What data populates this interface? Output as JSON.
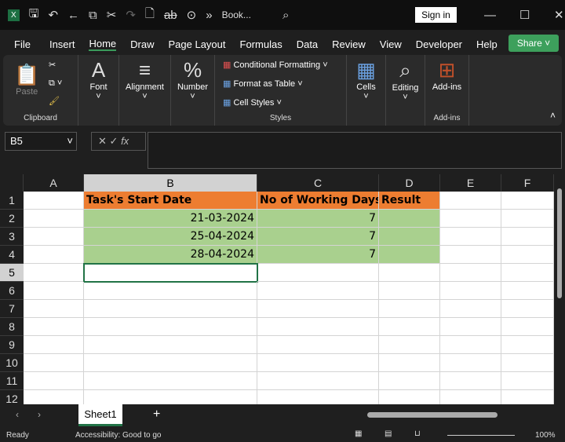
{
  "titlebar": {
    "title": "Book...",
    "sign_in": "Sign in"
  },
  "menu": [
    "File",
    "Insert",
    "Home",
    "Draw",
    "Page Layout",
    "Formulas",
    "Data",
    "Review",
    "View",
    "Developer",
    "Help"
  ],
  "share": "Share",
  "ribbon": {
    "paste": "Paste",
    "clipboard": "Clipboard",
    "font": "Font",
    "alignment": "Alignment",
    "number": "Number",
    "conditional_formatting": "Conditional Formatting",
    "format_as_table": "Format as Table",
    "cell_styles": "Cell Styles",
    "styles": "Styles",
    "cells": "Cells",
    "editing": "Editing",
    "addins": "Add-ins",
    "addins_group": "Add-ins"
  },
  "formula_bar": {
    "name_box": "B5",
    "fx": "fx",
    "value": ""
  },
  "columns": [
    "A",
    "B",
    "C",
    "D",
    "E",
    "F"
  ],
  "rows": [
    "1",
    "2",
    "3",
    "4",
    "5",
    "6",
    "7",
    "8",
    "9",
    "10",
    "11",
    "12"
  ],
  "table": {
    "headers": [
      "Task's Start Date",
      "No of Working Days",
      "Result"
    ],
    "rows": [
      [
        "21-03-2024",
        "7",
        ""
      ],
      [
        "25-04-2024",
        "7",
        ""
      ],
      [
        "28-04-2024",
        "7",
        ""
      ]
    ]
  },
  "colors": {
    "header": "#ed7d31",
    "data": "#a9d08e",
    "accent": "#217346"
  },
  "sheets": [
    "Sheet1"
  ],
  "status": {
    "ready": "Ready",
    "accessibility": "Accessibility: Good to go",
    "zoom": "100%"
  }
}
